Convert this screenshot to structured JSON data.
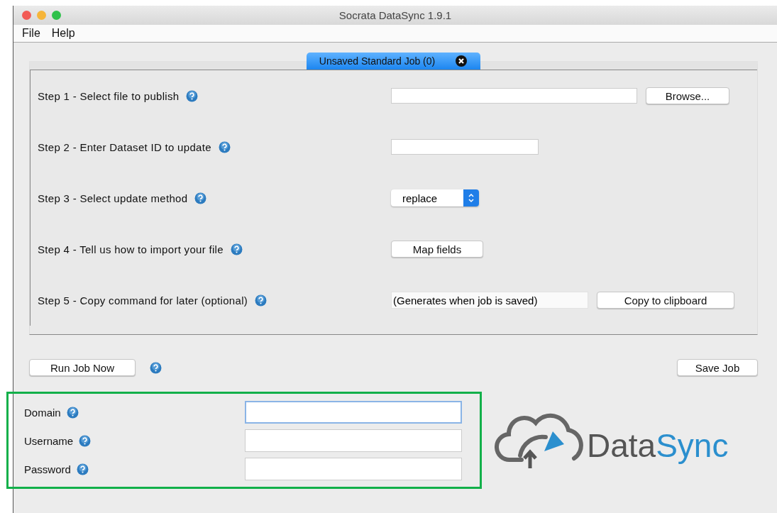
{
  "window": {
    "title": "Socrata DataSync 1.9.1"
  },
  "menu": [
    "File",
    "Help"
  ],
  "tabs": [
    {
      "label": "Unsaved Standard Job (0)",
      "selected": true
    }
  ],
  "steps": [
    {
      "label": "Step 1 - Select file to publish",
      "kind": "file",
      "buttons": [
        "Browse..."
      ]
    },
    {
      "label": "Step 2 - Enter Dataset ID to update",
      "kind": "text"
    },
    {
      "label": "Step 3 - Select update method",
      "kind": "select",
      "value": "replace"
    },
    {
      "label": "Step 4 - Tell us how to import your file",
      "kind": "button",
      "buttons": [
        "Map fields"
      ]
    },
    {
      "label": "Step 5 - Copy command for later (optional)",
      "kind": "command",
      "value": "(Generates when job is saved)",
      "buttons": [
        "Copy to clipboard"
      ]
    }
  ],
  "actions": {
    "run": "Run Job Now",
    "save": "Save Job"
  },
  "credentials": {
    "highlighted": true,
    "fields": [
      {
        "label": "Domain",
        "focused": true
      },
      {
        "label": "Username",
        "focused": false
      },
      {
        "label": "Password",
        "focused": false
      }
    ]
  },
  "logo": {
    "text_main": "Data",
    "text_accent": "Sync"
  }
}
